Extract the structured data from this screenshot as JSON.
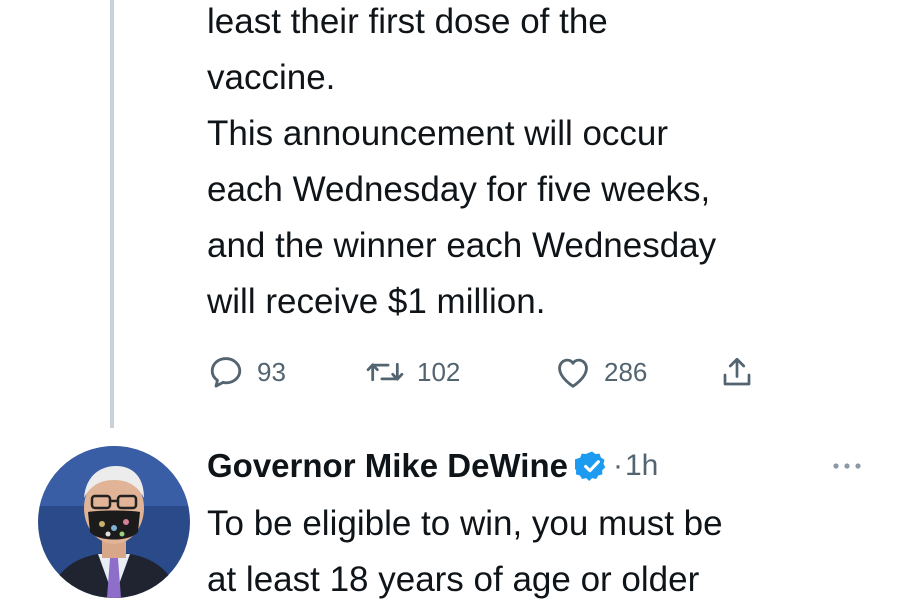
{
  "tweet1": {
    "lines": [
      "least their first dose of the",
      "vaccine.",
      "This announcement will occur",
      "each Wednesday for five weeks,",
      "and the winner each Wednesday",
      "will receive $1 million."
    ],
    "actions": {
      "reply_count": "93",
      "retweet_count": "102",
      "like_count": "286"
    }
  },
  "tweet2": {
    "author_name": "Governor Mike DeWine",
    "separator": "·",
    "time": "1h",
    "lines": [
      "To be eligible to win, you must be",
      "at least 18 years of age or older"
    ]
  },
  "icons": {
    "reply": "reply-icon",
    "retweet": "retweet-icon",
    "like": "heart-icon",
    "share": "share-icon",
    "verified": "verified-badge-icon",
    "more": "more-options-icon"
  },
  "colors": {
    "text": "#0f1419",
    "secondary": "#536471",
    "verified": "#1d9bf0",
    "thread_line": "#c9d2da"
  }
}
